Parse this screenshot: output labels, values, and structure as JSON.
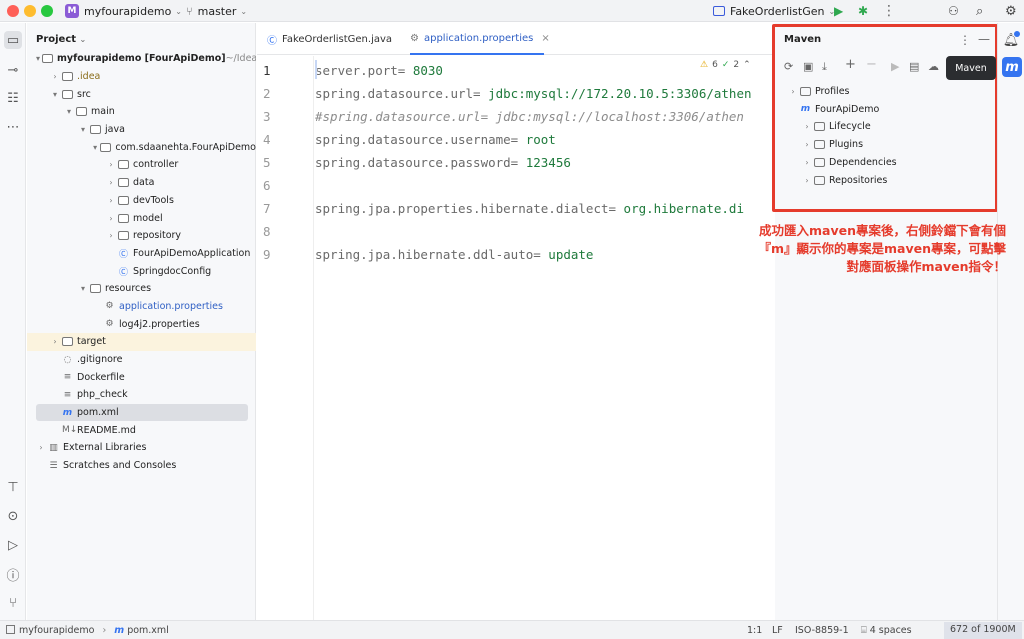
{
  "titlebar": {
    "project_badge": "M",
    "project_name": "myfourapidemo",
    "branch": "master",
    "run_config": "FakeOrderlistGen"
  },
  "project_panel": {
    "title": "Project",
    "tree": [
      {
        "indent": 0,
        "arrow": "▾",
        "icon": "folder",
        "label": "myfourapidemo [FourApiDemo]",
        "suffix": " ~/IdeaPro",
        "bold": true
      },
      {
        "indent": 1,
        "arrow": "›",
        "icon": "folder",
        "label": ".idea",
        "color": "#8a6d1a"
      },
      {
        "indent": 1,
        "arrow": "▾",
        "icon": "folder",
        "label": "src"
      },
      {
        "indent": 2,
        "arrow": "▾",
        "icon": "folder",
        "label": "main"
      },
      {
        "indent": 3,
        "arrow": "▾",
        "icon": "folder",
        "label": "java"
      },
      {
        "indent": 4,
        "arrow": "▾",
        "icon": "folder",
        "label": "com.sdaanehta.FourApiDemo"
      },
      {
        "indent": 5,
        "arrow": "›",
        "icon": "folder",
        "label": "controller"
      },
      {
        "indent": 5,
        "arrow": "›",
        "icon": "folder",
        "label": "data"
      },
      {
        "indent": 5,
        "arrow": "›",
        "icon": "folder",
        "label": "devTools"
      },
      {
        "indent": 5,
        "arrow": "›",
        "icon": "folder",
        "label": "model"
      },
      {
        "indent": 5,
        "arrow": "›",
        "icon": "folder",
        "label": "repository"
      },
      {
        "indent": 5,
        "arrow": "",
        "icon": "class",
        "label": "FourApiDemoApplication"
      },
      {
        "indent": 5,
        "arrow": "",
        "icon": "class",
        "label": "SpringdocConfig"
      },
      {
        "indent": 3,
        "arrow": "▾",
        "icon": "folder",
        "label": "resources"
      },
      {
        "indent": 4,
        "arrow": "",
        "icon": "gear",
        "label": "application.properties",
        "color": "#2f5fc4"
      },
      {
        "indent": 4,
        "arrow": "",
        "icon": "gear",
        "label": "log4j2.properties"
      },
      {
        "indent": 1,
        "arrow": "›",
        "icon": "folder",
        "label": "target",
        "hl": true
      },
      {
        "indent": 1,
        "arrow": "",
        "icon": "dot",
        "label": ".gitignore"
      },
      {
        "indent": 1,
        "arrow": "",
        "icon": "doc",
        "label": "Dockerfile"
      },
      {
        "indent": 1,
        "arrow": "",
        "icon": "doc",
        "label": "php_check"
      },
      {
        "indent": 1,
        "arrow": "",
        "icon": "m",
        "label": "pom.xml",
        "sel": true
      },
      {
        "indent": 1,
        "arrow": "",
        "icon": "md",
        "label": "README.md"
      },
      {
        "indent": 0,
        "arrow": "›",
        "icon": "lib",
        "label": "External Libraries"
      },
      {
        "indent": 0,
        "arrow": "",
        "icon": "scratch",
        "label": "Scratches and Consoles"
      }
    ]
  },
  "editor": {
    "tabs": [
      {
        "label": "FakeOrderlistGen.java",
        "active": false
      },
      {
        "label": "application.properties",
        "active": true
      }
    ],
    "inspections": {
      "warnings": "6",
      "ok": "2"
    },
    "line_numbers": [
      "1",
      "2",
      "3",
      "4",
      "5",
      "6",
      "7",
      "8",
      "9"
    ],
    "lines": [
      {
        "key": "server.port=",
        "val": " 8030"
      },
      {
        "key": "spring.datasource.url=",
        "val": " jdbc:mysql://172.20.10.5:3306/athen"
      },
      {
        "comment": "#spring.datasource.url= jdbc:mysql://localhost:3306/athen"
      },
      {
        "key": "spring.datasource.username=",
        "val": " root"
      },
      {
        "key": "spring.datasource.password=",
        "val": " 123456"
      },
      {
        "key": "",
        "val": ""
      },
      {
        "key": "spring.jpa.properties.hibernate.dialect=",
        "val": " org.hibernate.di"
      },
      {
        "key": "",
        "val": ""
      },
      {
        "key": "spring.jpa.hibernate.ddl-auto=",
        "val": " update"
      }
    ]
  },
  "maven": {
    "title": "Maven",
    "tooltip": "Maven",
    "badge": "m",
    "tree": [
      {
        "label": "Profiles",
        "indent": 0
      },
      {
        "label": "FourApiDemo",
        "indent": 0,
        "expanded": true,
        "maven": true
      },
      {
        "label": "Lifecycle",
        "indent": 1
      },
      {
        "label": "Plugins",
        "indent": 1
      },
      {
        "label": "Dependencies",
        "indent": 1
      },
      {
        "label": "Repositories",
        "indent": 1
      }
    ]
  },
  "annotation": {
    "line1": "成功匯入maven專案後，右側鈴鐺下會有個",
    "line2": "『m』顯示你的專案是maven專案，可點擊",
    "line3": "對應面板操作maven指令！"
  },
  "statusbar": {
    "project": "myfourapidemo",
    "file": "pom.xml",
    "position": "1:1",
    "line_sep": "LF",
    "encoding": "ISO-8859-1",
    "indent": "4 spaces",
    "memory": "672 of 1900M"
  },
  "colors": {
    "accent": "#3574f0",
    "annotation": "#e53b2c",
    "project_badge": "#8b5cd6"
  }
}
